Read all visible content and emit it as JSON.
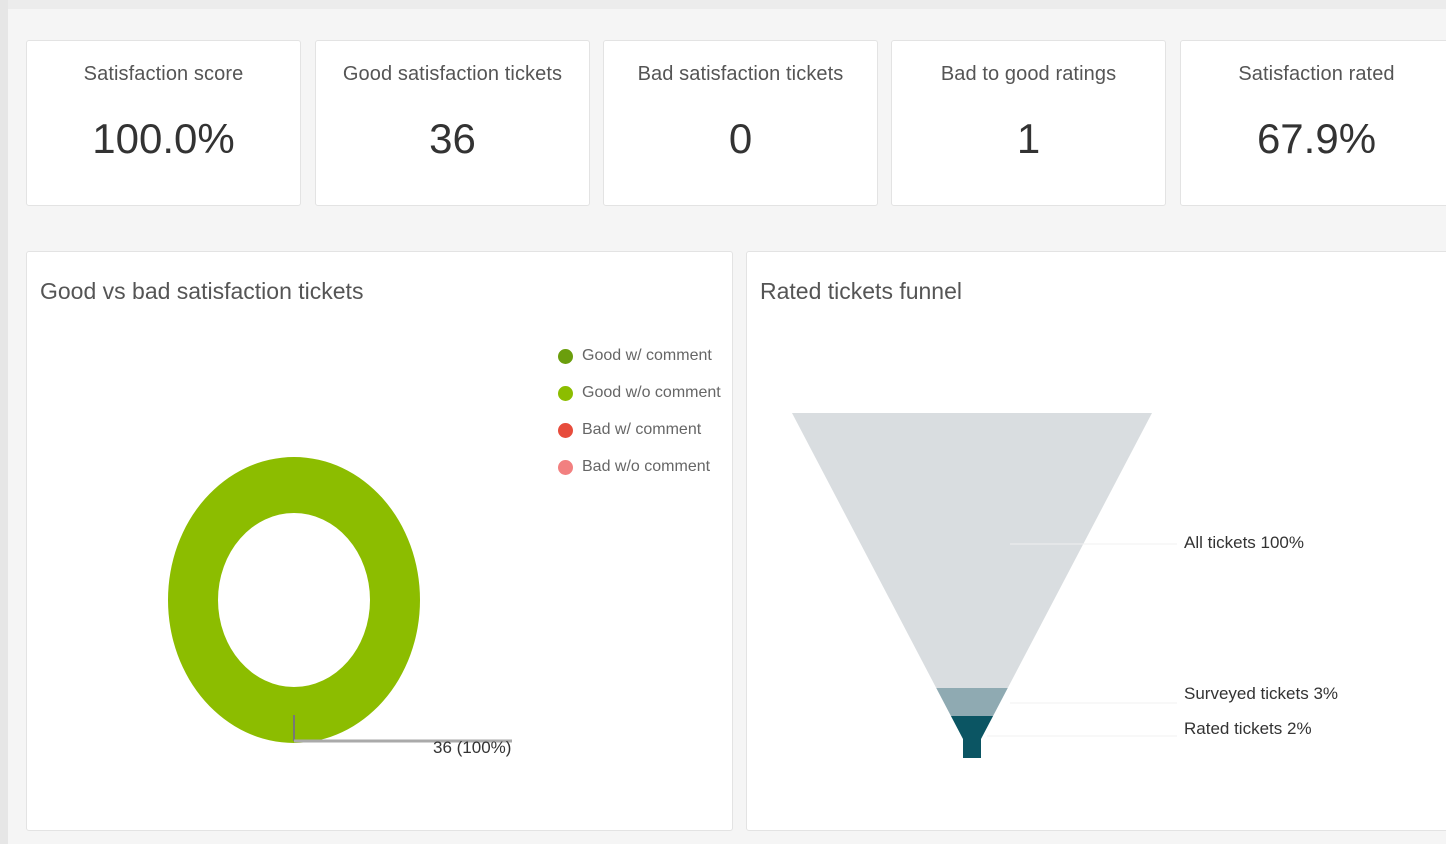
{
  "kpis": [
    {
      "title": "Satisfaction score",
      "value": "100.0%"
    },
    {
      "title": "Good satisfaction tickets",
      "value": "36"
    },
    {
      "title": "Bad satisfaction tickets",
      "value": "0"
    },
    {
      "title": "Bad to good ratings",
      "value": "1"
    },
    {
      "title": "Satisfaction rated",
      "value": "67.9%"
    }
  ],
  "donut_panel": {
    "title": "Good vs bad satisfaction tickets",
    "slice_label": "36 (100%)"
  },
  "funnel_panel": {
    "title": "Rated tickets funnel",
    "labels": [
      "All tickets 100%",
      "Surveyed tickets 3%",
      "Rated tickets 2%"
    ]
  },
  "chart_data": [
    {
      "type": "pie",
      "title": "Good vs bad satisfaction tickets",
      "categories": [
        "Good w/ comment",
        "Good w/o comment",
        "Bad w/ comment",
        "Bad w/o comment"
      ],
      "values": [
        0,
        36,
        0,
        0
      ],
      "colors": [
        "#6b9e0d",
        "#8cbd00",
        "#e74c3c",
        "#f28080"
      ],
      "legend": "top-right"
    },
    {
      "type": "bar",
      "subtype": "funnel",
      "title": "Rated tickets funnel",
      "categories": [
        "All tickets",
        "Surveyed tickets",
        "Rated tickets"
      ],
      "values": [
        100,
        3,
        2
      ],
      "colors": [
        "#d9dde0",
        "#8faab2",
        "#0b5563"
      ]
    }
  ]
}
